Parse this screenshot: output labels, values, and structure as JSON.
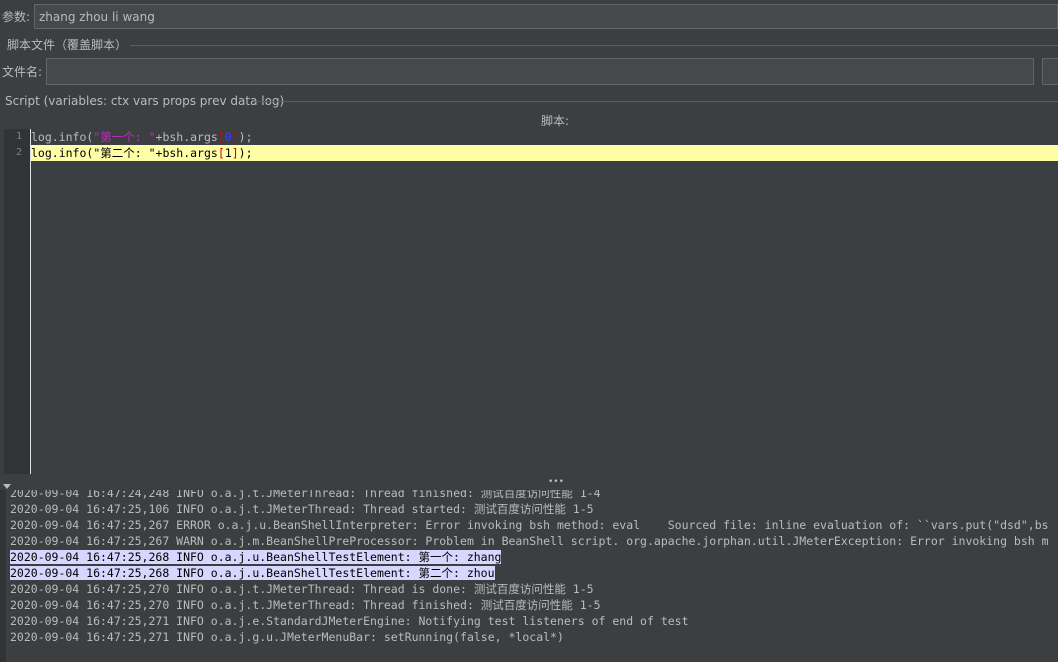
{
  "params": {
    "label": "参数:",
    "value": "zhang zhou li wang"
  },
  "script_file_section": {
    "title": "脚本文件（覆盖脚本）",
    "filename_label": "文件名:",
    "filename_value": ""
  },
  "script_section": {
    "title": "Script (variables: ctx vars props prev data log)",
    "editor_header": "脚本:"
  },
  "editor": {
    "lines": [
      {
        "num": "1",
        "parts": [
          "log.info(",
          "\"第一个: \"",
          "+bsh.args",
          "[",
          "0",
          "]",
          ");"
        ]
      },
      {
        "num": "2",
        "parts": [
          "log.info(",
          "\"第二个: \"",
          "+bsh.args",
          "[",
          "1",
          "]",
          ");"
        ]
      }
    ],
    "current_line": 2
  },
  "splitter": {
    "grip": "•••"
  },
  "log": {
    "lines": [
      "2020-09-04 16:47:24,248 INFO o.a.j.t.JMeterThread: Thread finished: 测试百度访问性能 1-4",
      "2020-09-04 16:47:25,106 INFO o.a.j.t.JMeterThread: Thread started: 测试百度访问性能 1-5",
      "2020-09-04 16:47:25,267 ERROR o.a.j.u.BeanShellInterpreter: Error invoking bsh method: eval    Sourced file: inline evaluation of: ``vars.put(\"dsd\",bs",
      "2020-09-04 16:47:25,267 WARN o.a.j.m.BeanShellPreProcessor: Problem in BeanShell script. org.apache.jorphan.util.JMeterException: Error invoking bsh m",
      "2020-09-04 16:47:25,268 INFO o.a.j.u.BeanShellTestElement: 第一个: zhang",
      "2020-09-04 16:47:25,268 INFO o.a.j.u.BeanShellTestElement: 第二个: zhou",
      "2020-09-04 16:47:25,270 INFO o.a.j.t.JMeterThread: Thread is done: 测试百度访问性能 1-5",
      "2020-09-04 16:47:25,270 INFO o.a.j.t.JMeterThread: Thread finished: 测试百度访问性能 1-5",
      "2020-09-04 16:47:25,271 INFO o.a.j.e.StandardJMeterEngine: Notifying test listeners of end of test",
      "2020-09-04 16:47:25,271 INFO o.a.j.g.u.JMeterMenuBar: setRunning(false, *local*)"
    ],
    "selected": [
      4,
      5
    ]
  },
  "colors": {
    "background": "#3c3f41",
    "editor_bg": "#2b2b2b",
    "current_line": "#fefea7",
    "log_selection": "#d6d6ff",
    "string": "#bb2ec0",
    "number": "#3b3bff",
    "bracket": "#d00000"
  },
  "icons": {
    "collapse": "triangle-down-icon"
  }
}
